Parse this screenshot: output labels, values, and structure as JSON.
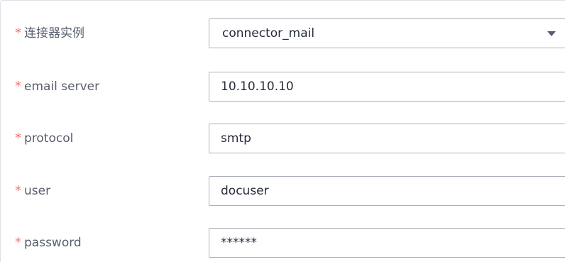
{
  "form": {
    "fields": [
      {
        "label": "连接器实例",
        "value": "connector_mail",
        "required_mark": "*"
      },
      {
        "label": "email server",
        "value": "10.10.10.10",
        "required_mark": "*"
      },
      {
        "label": "protocol",
        "value": "smtp",
        "required_mark": "*"
      },
      {
        "label": "user",
        "value": "docuser",
        "required_mark": "*"
      },
      {
        "label": "password",
        "value": "******",
        "required_mark": "*"
      }
    ]
  },
  "colors": {
    "required_star": "#f66f6a",
    "label_text": "#575d6c",
    "input_border": "#adb0b8",
    "input_text": "#252b3a"
  },
  "icons": {
    "dropdown": "caret-down-icon"
  }
}
